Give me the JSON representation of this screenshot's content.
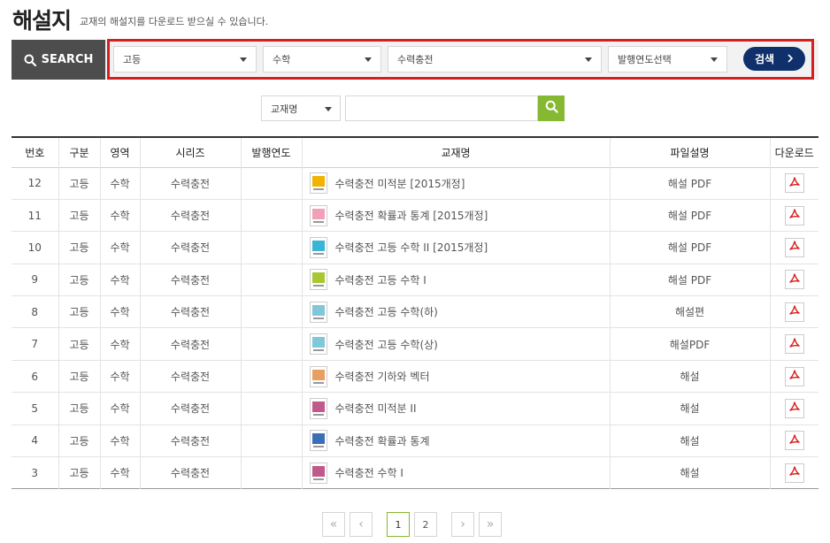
{
  "header": {
    "title": "해설지",
    "subtitle": "교재의 해설지를 다운로드 받으실 수 있습니다."
  },
  "search": {
    "label": "SEARCH",
    "level": "고등",
    "subject": "수학",
    "series": "수력충전",
    "year": "발행연도선택",
    "button": "검색"
  },
  "filter": {
    "field": "교재명",
    "query": ""
  },
  "table": {
    "headers": [
      "번호",
      "구분",
      "영역",
      "시리즈",
      "발행연도",
      "교재명",
      "파일설명",
      "다운로드"
    ],
    "rows": [
      {
        "no": "12",
        "level": "고등",
        "area": "수학",
        "series": "수력충전",
        "year": "",
        "title": "수력충전 미적분 [2015개정]",
        "desc": "해설 PDF"
      },
      {
        "no": "11",
        "level": "고등",
        "area": "수학",
        "series": "수력충전",
        "year": "",
        "title": "수력충전 확률과 통계 [2015개정]",
        "desc": "해설 PDF"
      },
      {
        "no": "10",
        "level": "고등",
        "area": "수학",
        "series": "수력충전",
        "year": "",
        "title": "수력충전 고등 수학 II [2015개정]",
        "desc": "해설 PDF"
      },
      {
        "no": "9",
        "level": "고등",
        "area": "수학",
        "series": "수력충전",
        "year": "",
        "title": "수력충전 고등 수학 I",
        "desc": "해설 PDF"
      },
      {
        "no": "8",
        "level": "고등",
        "area": "수학",
        "series": "수력충전",
        "year": "",
        "title": "수력충전 고등 수학(하)",
        "desc": "해설편"
      },
      {
        "no": "7",
        "level": "고등",
        "area": "수학",
        "series": "수력충전",
        "year": "",
        "title": "수력충전 고등 수학(상)",
        "desc": "해설PDF"
      },
      {
        "no": "6",
        "level": "고등",
        "area": "수학",
        "series": "수력충전",
        "year": "",
        "title": "수력충전 기하와 벡터",
        "desc": "해설"
      },
      {
        "no": "5",
        "level": "고등",
        "area": "수학",
        "series": "수력충전",
        "year": "",
        "title": "수력충전 미적분 II",
        "desc": "해설"
      },
      {
        "no": "4",
        "level": "고등",
        "area": "수학",
        "series": "수력충전",
        "year": "",
        "title": "수력충전 확률과 통계",
        "desc": "해설"
      },
      {
        "no": "3",
        "level": "고등",
        "area": "수학",
        "series": "수력충전",
        "year": "",
        "title": "수력충전 수학 I",
        "desc": "해설"
      }
    ]
  },
  "pagination": {
    "first": "«",
    "prev": "‹",
    "pages": [
      "1",
      "2"
    ],
    "next": "›",
    "last": "»",
    "current": "1"
  },
  "colors": {
    "search_label_bg": "#4d4d4d",
    "highlight_frame": "#d61f1f",
    "search_button": "#10306b",
    "filter_button": "#86b832",
    "pdf_icon": "#d42020",
    "thumb_colors": [
      "#f0b400",
      "#f2a0b8",
      "#3ab5d8",
      "#a8c832",
      "#7ec8d8",
      "#7ec8d8",
      "#e8a060",
      "#c05a8a",
      "#3a6fb8",
      "#c05a8a"
    ]
  },
  "icons": {
    "search_label_icon": "search-icon",
    "filter_button_icon": "search-icon",
    "download_icon": "pdf-icon",
    "search_button_icon": "chevron-right-icon"
  }
}
